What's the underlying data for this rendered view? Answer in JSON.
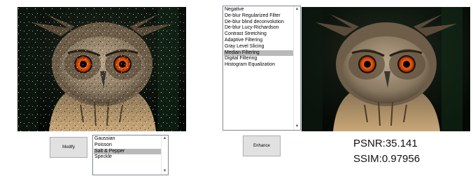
{
  "images": {
    "input": {
      "icon": "owl-photo-noisy"
    },
    "output": {
      "icon": "owl-photo-restored"
    }
  },
  "buttons": {
    "modify_label": "Modify",
    "enhance_label": "Enhance"
  },
  "noise_list": {
    "items": [
      "Gaussian",
      "Poisson",
      "Salt & Pepper",
      "Speckle"
    ],
    "selected": "Salt & Pepper"
  },
  "filter_list": {
    "items": [
      "Negative",
      "De-blur Regularized Filter",
      "De-blur blind deconvolution",
      "De-blur Lucy-Richardson",
      "Contrast Stretching",
      "Adaptive Filtering",
      "Gray Level Slicing",
      "Median Filtering",
      "Digital Filtering",
      "Histogram Equalization"
    ],
    "selected": "Median Filtering"
  },
  "metrics": {
    "psnr_text": "PSNR:35.141",
    "ssim_text": "SSIM:0.97956"
  },
  "colors": {
    "selection": "#b9b9b9",
    "button_face": "#e1e1e1"
  }
}
